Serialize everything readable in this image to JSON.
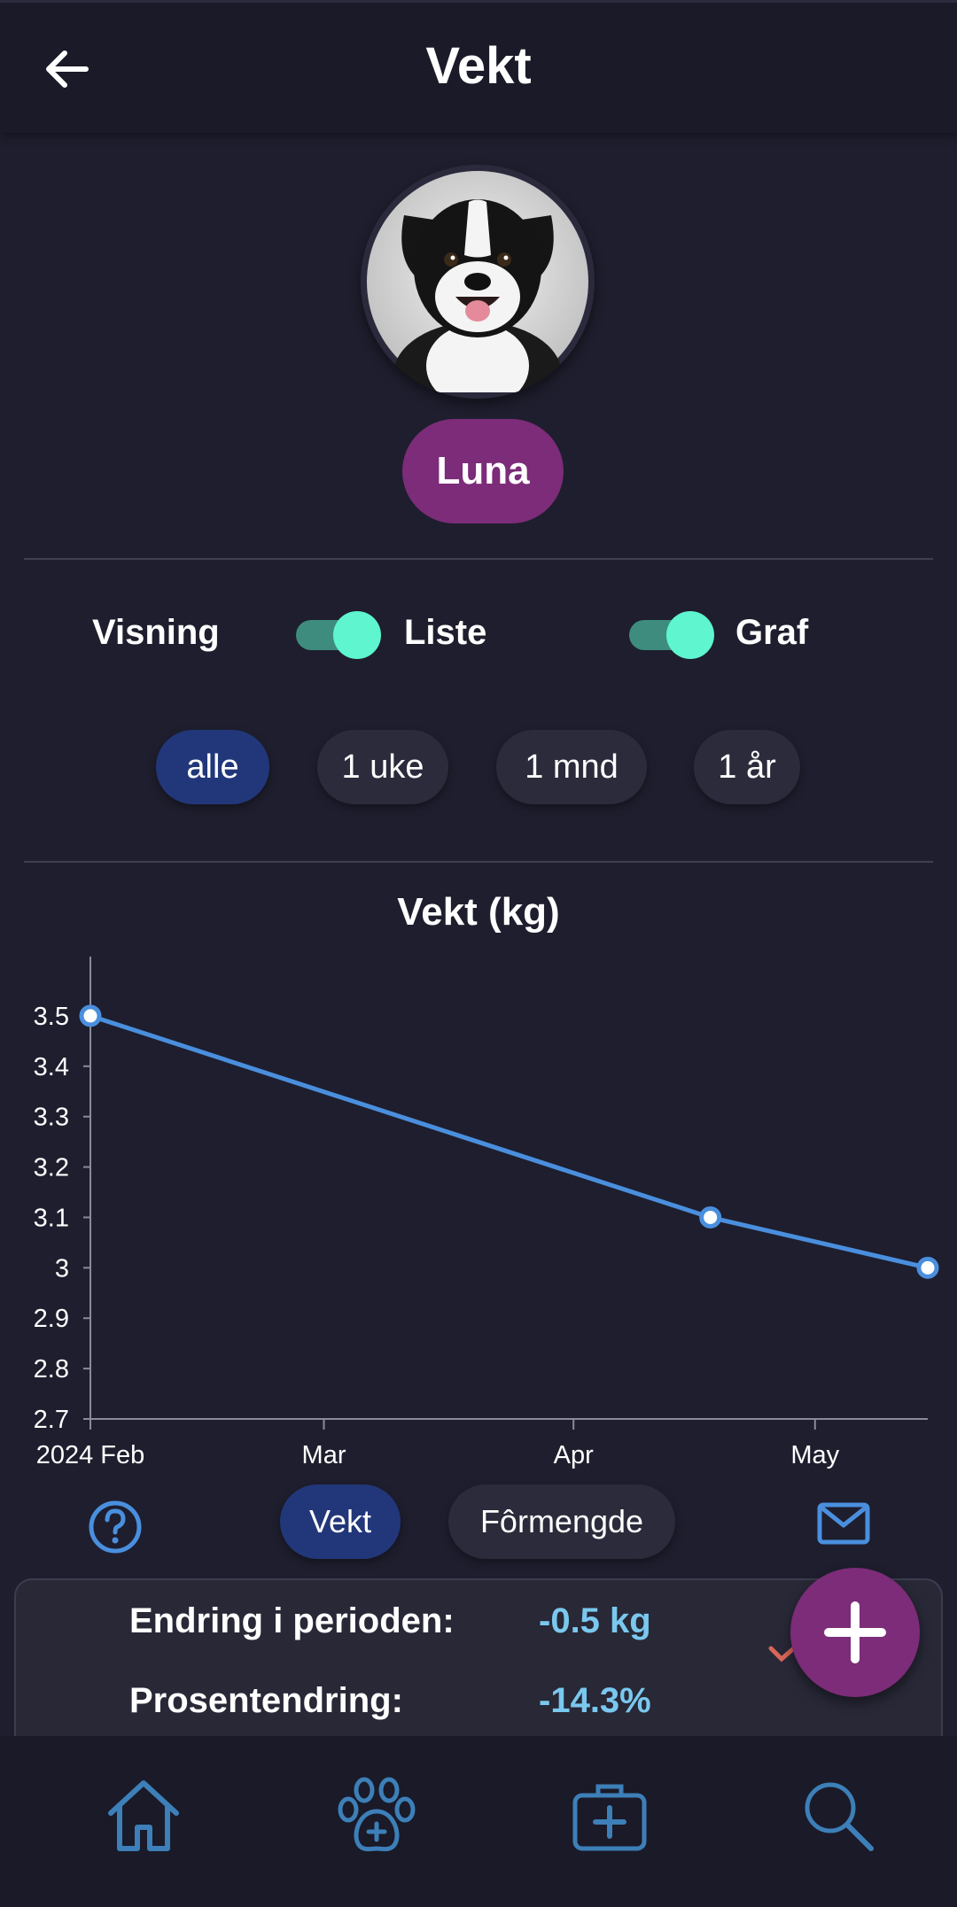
{
  "header": {
    "title": "Vekt",
    "back_icon": "arrow-left-icon"
  },
  "pet": {
    "name": "Luna",
    "avatar": "border-collie-dog-portrait"
  },
  "view_controls": {
    "label": "Visning",
    "list_toggle": {
      "label": "Liste",
      "on": true
    },
    "graph_toggle": {
      "label": "Graf",
      "on": true
    }
  },
  "range_filters": {
    "options": [
      "alle",
      "1 uke",
      "1 mnd",
      "1 år"
    ],
    "selected": "alle"
  },
  "chart_data": {
    "type": "line",
    "title": "Vekt (kg)",
    "x": [
      "2024-02-01",
      "2024-04-18",
      "2024-05-15"
    ],
    "series": [
      {
        "values": [
          3.5,
          3.1,
          3.0
        ]
      }
    ],
    "x_ticks": [
      "2024 Feb",
      "Mar",
      "Apr",
      "May"
    ],
    "y_ticks": [
      "3.5",
      "3.4",
      "3.3",
      "3.2",
      "3.1",
      "3",
      "2.9",
      "2.8",
      "2.7"
    ],
    "xlim": [
      "2024-02-01",
      "2024-05-15"
    ],
    "ylim": [
      2.7,
      3.6
    ],
    "grid": false,
    "line_color": "#4a8fde"
  },
  "metric_tabs": {
    "options": [
      "Vekt",
      "Fôrmengde"
    ],
    "selected": "Vekt",
    "help_icon": "question-circle-icon",
    "mail_icon": "mail-icon"
  },
  "summary": {
    "change_label": "Endring i perioden:",
    "change_value": "-0.5 kg",
    "percent_label": "Prosentendring:",
    "percent_value": "-14.3%"
  },
  "fab": {
    "icon": "plus-icon"
  },
  "bottom_nav": {
    "items": [
      {
        "icon": "home-icon"
      },
      {
        "icon": "paw-plus-icon"
      },
      {
        "icon": "medical-kit-icon"
      },
      {
        "icon": "search-icon"
      }
    ]
  },
  "colors": {
    "background": "#1e1e2e",
    "pet_chip": "#7c2c78",
    "active_chip": "#22377a",
    "toggle_knob": "#5ef5cf",
    "accent_value": "#7ac8ee",
    "nav_icon": "#3d7fb8"
  }
}
